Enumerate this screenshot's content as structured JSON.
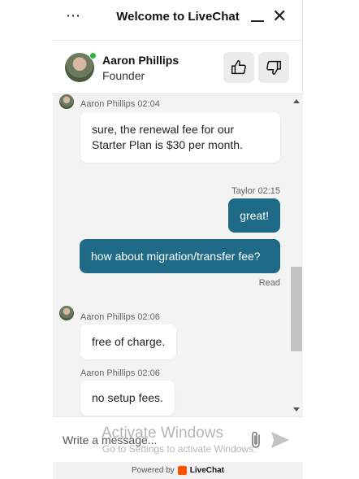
{
  "window": {
    "title": "Welcome to LiveChat",
    "menu_icon": "⋯",
    "close_glyph": "✕"
  },
  "agent": {
    "name": "Aaron Phillips",
    "role": "Founder"
  },
  "messages": [
    {
      "meta": "Aaron Phillips 02:04",
      "text": "sure, the renewal fee for our Starter Plan is $30 per month."
    },
    {
      "meta": "Taylor 02:15",
      "text": "great!"
    },
    {
      "text": "how about migration/transfer fee?",
      "status": "Read"
    },
    {
      "meta": "Aaron Phillips 02:06",
      "text": "free of charge."
    },
    {
      "meta": "Aaron Phillips 02:06",
      "text": "no setup fees."
    }
  ],
  "composer": {
    "placeholder": "Write a message..."
  },
  "watermark": {
    "title": "Activate Windows",
    "subtitle": "Go to Settings to activate Windows."
  },
  "footer": {
    "powered_by": "Powered by",
    "brand": "LiveChat"
  },
  "colors": {
    "outgoing_bubble": "#1f6a87",
    "online": "#2fb24a",
    "brand": "#ff5100"
  }
}
